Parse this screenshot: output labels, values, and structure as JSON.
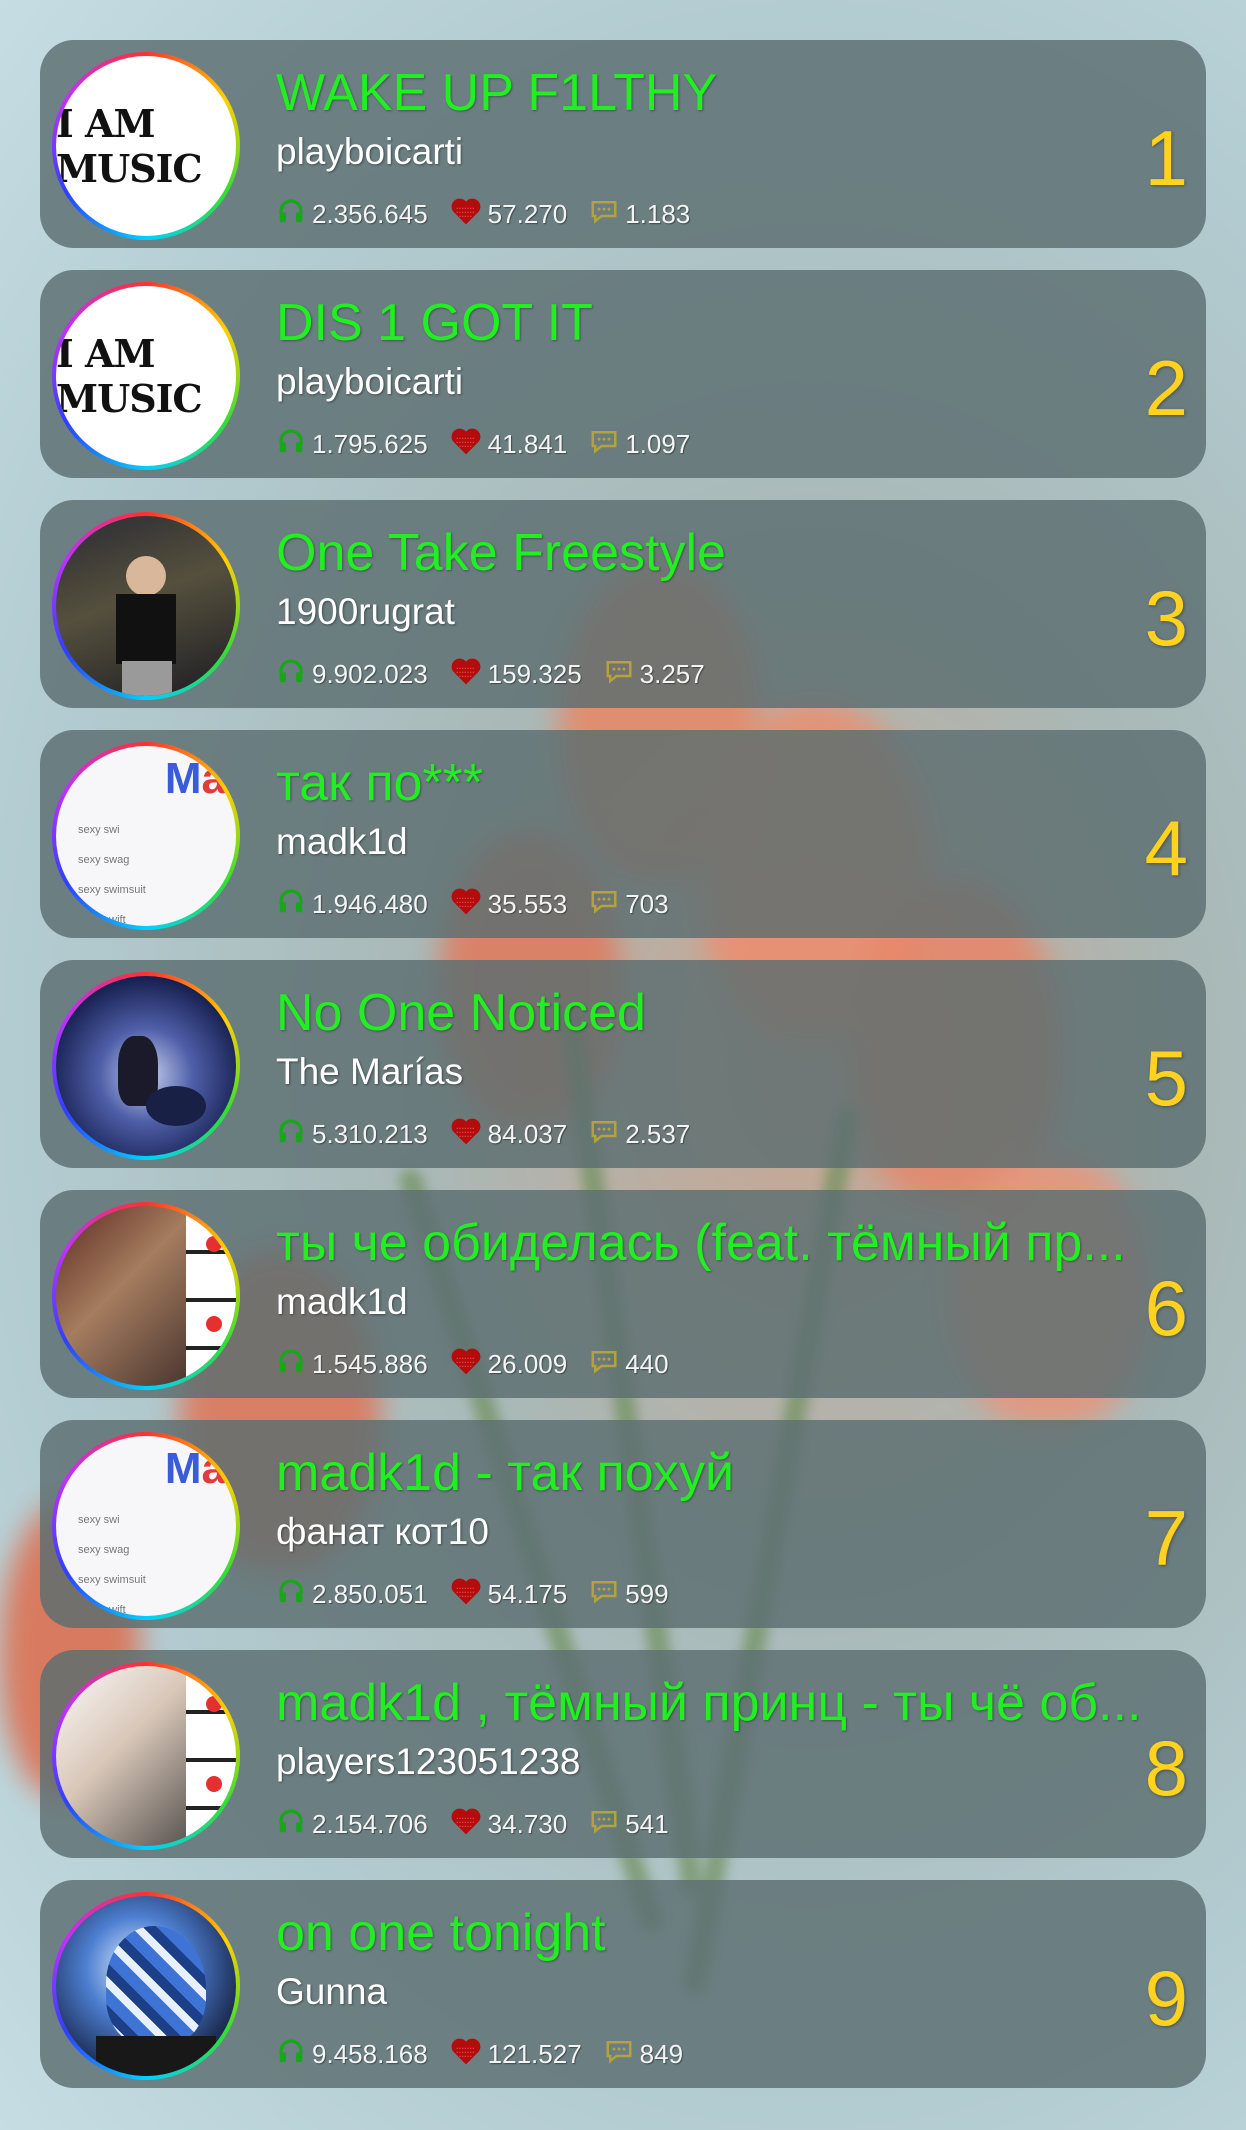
{
  "tracks": [
    {
      "rank": "1",
      "title": "WAKE UP F1LTHY",
      "artist": "playboicarti",
      "plays": "2.356.645",
      "likes": "57.270",
      "comments": "1.183",
      "cover": "i-am-music",
      "cover_text": "I AM MUSIC"
    },
    {
      "rank": "2",
      "title": "DIS 1 GOT IT",
      "artist": "playboicarti",
      "plays": "1.795.625",
      "likes": "41.841",
      "comments": "1.097",
      "cover": "i-am-music",
      "cover_text": "I AM MUSIC"
    },
    {
      "rank": "3",
      "title": "One Take Freestyle",
      "artist": "1900rugrat",
      "plays": "9.902.023",
      "likes": "159.325",
      "comments": "3.257",
      "cover": "photo-dark",
      "cover_text": ""
    },
    {
      "rank": "4",
      "title": "так по***",
      "artist": "madk1d",
      "plays": "1.946.480",
      "likes": "35.553",
      "comments": "703",
      "cover": "search",
      "cover_text": ""
    },
    {
      "rank": "5",
      "title": "No One Noticed",
      "artist": "The Marías",
      "plays": "5.310.213",
      "likes": "84.037",
      "comments": "2.537",
      "cover": "photo-night",
      "cover_text": ""
    },
    {
      "rank": "6",
      "title": "ты че обиделась (feat. тёмный пр...",
      "artist": "madk1d",
      "plays": "1.545.886",
      "likes": "26.009",
      "comments": "440",
      "cover": "photo-room",
      "cover_text": ""
    },
    {
      "rank": "7",
      "title": "madk1d - так похуй",
      "artist": "фанат кот10",
      "plays": "2.850.051",
      "likes": "54.175",
      "comments": "599",
      "cover": "search",
      "cover_text": ""
    },
    {
      "rank": "8",
      "title": "madk1d , тёмный принц - ты чё об...",
      "artist": "players123051238",
      "plays": "2.154.706",
      "likes": "34.730",
      "comments": "541",
      "cover": "photo-room2",
      "cover_text": ""
    },
    {
      "rank": "9",
      "title": "on one tonight",
      "artist": "Gunna",
      "plays": "9.458.168",
      "likes": "121.527",
      "comments": "849",
      "cover": "photo-blue",
      "cover_text": ""
    }
  ],
  "search_cover": {
    "logo_main": "M",
    "logo_accent": "a",
    "lines": [
      "sexy swi",
      "sexy swag",
      "sexy swimsuit",
      "sexy swift"
    ]
  },
  "colors": {
    "title": "#21ef21",
    "artist": "#ffffff",
    "rank": "#ffd21f",
    "card": "#5c6e70",
    "headphones": "#1aa51a",
    "heart": "#b40c0c",
    "comment": "#b5a23a"
  },
  "icons": {
    "plays": "headphones-icon",
    "likes": "heart-icon",
    "comments": "comment-icon"
  }
}
